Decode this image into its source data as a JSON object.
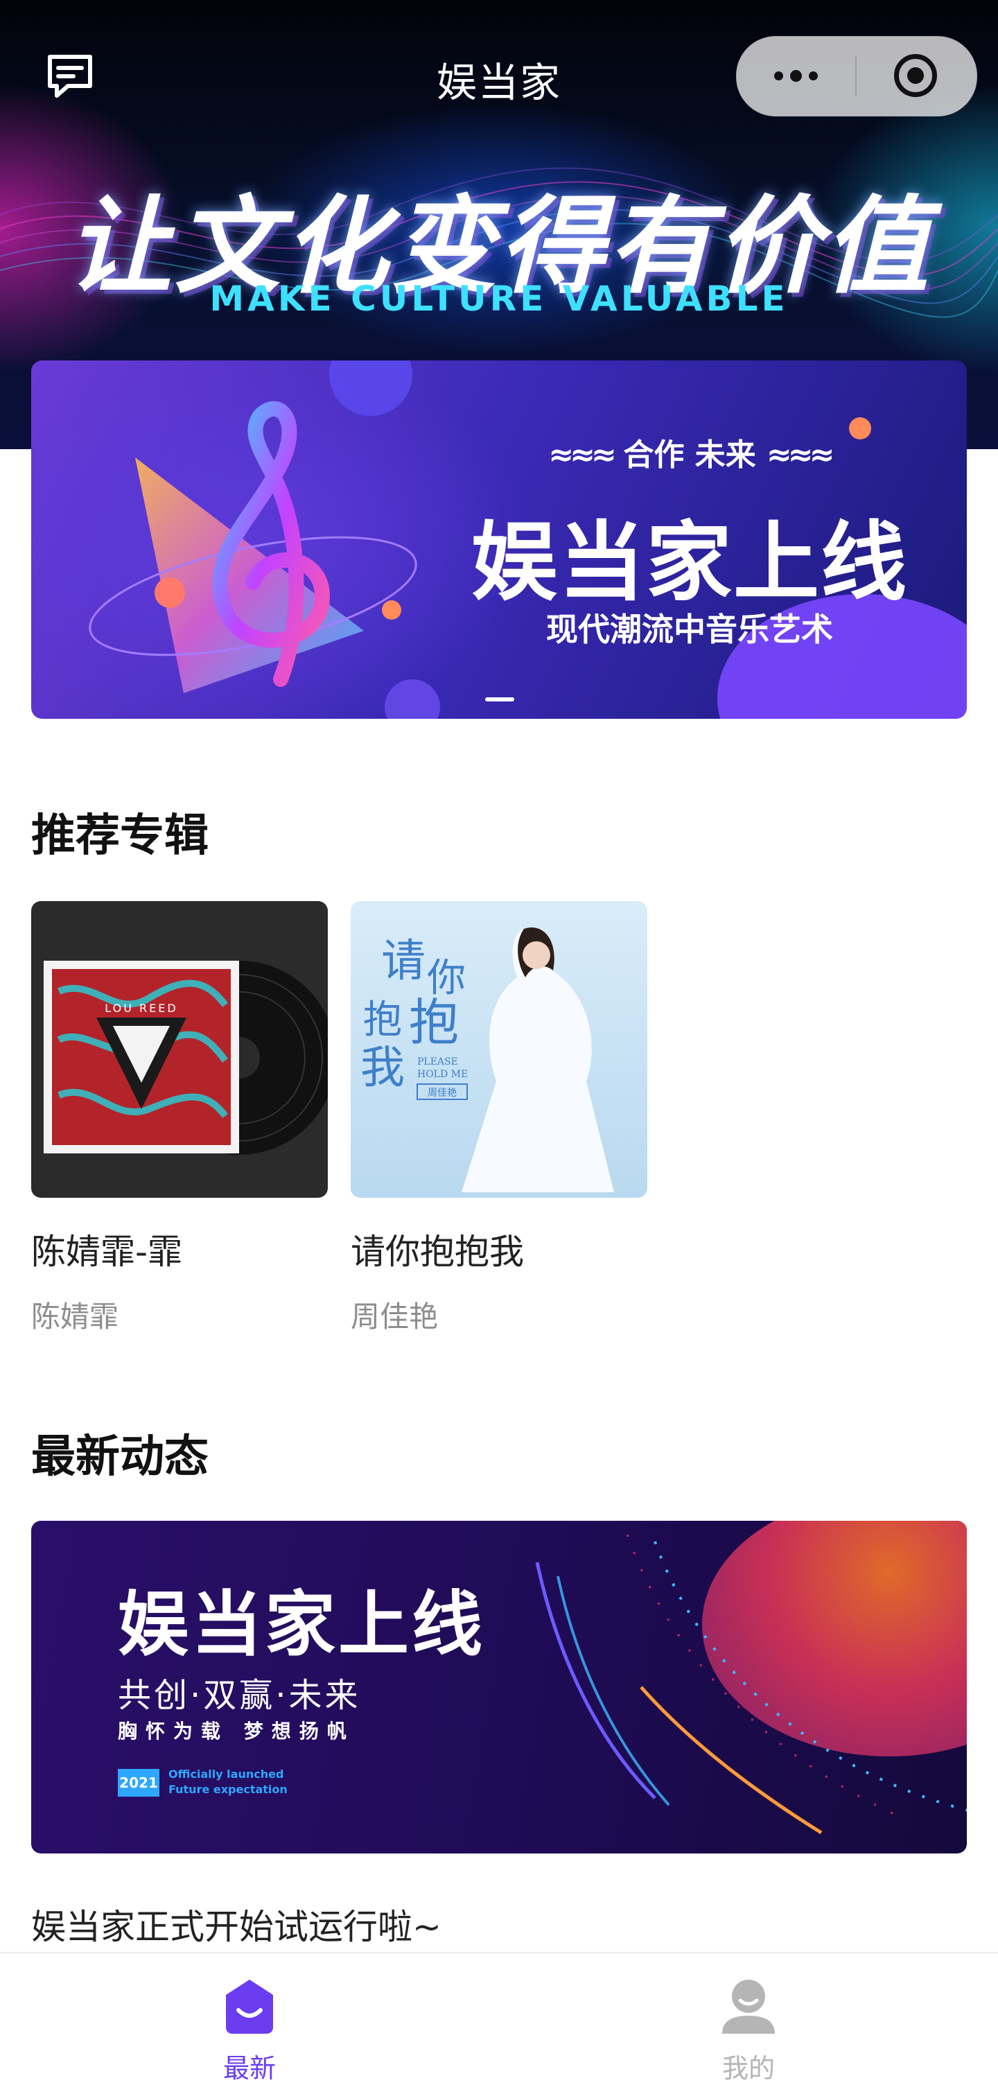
{
  "navbar": {
    "title": "娱当家"
  },
  "header": {
    "slogan_cn": "让文化变得有价值",
    "slogan_en": "MAKE CULTURE VALUABLE"
  },
  "banner": {
    "tagline": "合作 未来",
    "title": "娱当家上线",
    "subtitle": "现代潮流中音乐艺术"
  },
  "sections": {
    "albums_title": "推荐专辑",
    "news_title": "最新动态"
  },
  "albums": [
    {
      "name": "陈婧霏-霏",
      "artist": "陈婧霏",
      "cover_text": "LOU REED"
    },
    {
      "name": "请你抱抱我",
      "artist": "周佳艳",
      "cover_text_lines": [
        "请你",
        "抱抱",
        "我"
      ],
      "cover_en": "PLEASE HOLD ME",
      "cover_stamp": "周佳艳"
    }
  ],
  "news": {
    "title": "娱当家上线",
    "subtitle": "共创·双赢·未来",
    "slogan": "胸怀为载 梦想扬帆",
    "year": "2021",
    "tag1": "Officially launched",
    "tag2": "Future expectation",
    "caption": "娱当家正式开始试运行啦~"
  },
  "tabbar": {
    "tabs": [
      {
        "label": "最新",
        "icon": "home-smile-icon",
        "active": true
      },
      {
        "label": "我的",
        "icon": "user-icon",
        "active": false
      }
    ]
  },
  "colors": {
    "accent": "#6b3cf0",
    "inactive": "#b5b5b5"
  }
}
